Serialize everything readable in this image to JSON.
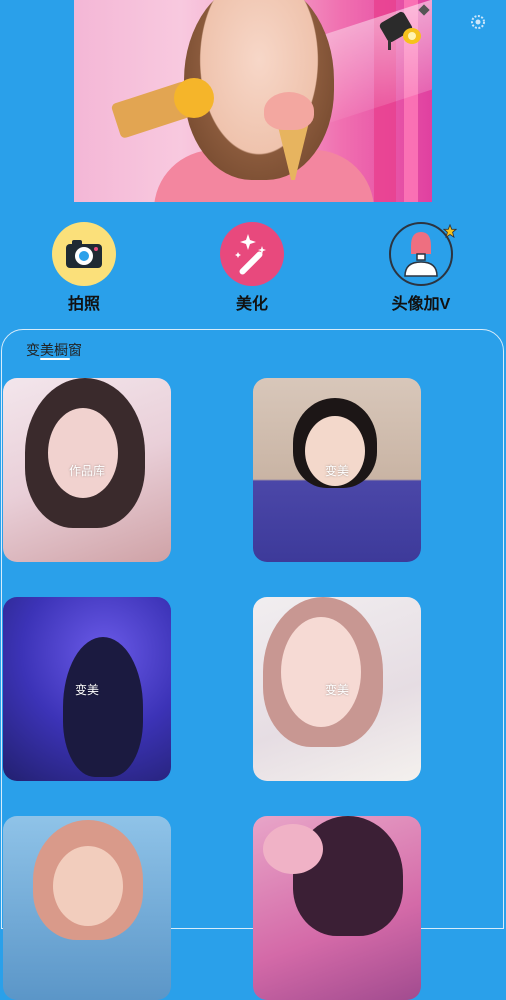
{
  "top": {
    "settings_icon": "gear-icon",
    "lamp_icon": "spotlight-icon"
  },
  "features": [
    {
      "label": "拍照",
      "icon": "camera-icon",
      "color": "#fbe07a"
    },
    {
      "label": "美化",
      "icon": "magic-wand-icon",
      "color": "#e8497d"
    },
    {
      "label": "头像加V",
      "icon": "avatar-v-icon",
      "color": "#2c3440"
    }
  ],
  "section": {
    "title": "变美橱窗"
  },
  "cards": [
    {
      "caption": "作品库"
    },
    {
      "caption": "变美"
    },
    {
      "caption": "变美"
    },
    {
      "caption": "变美"
    },
    {
      "caption": ""
    },
    {
      "caption": ""
    }
  ]
}
